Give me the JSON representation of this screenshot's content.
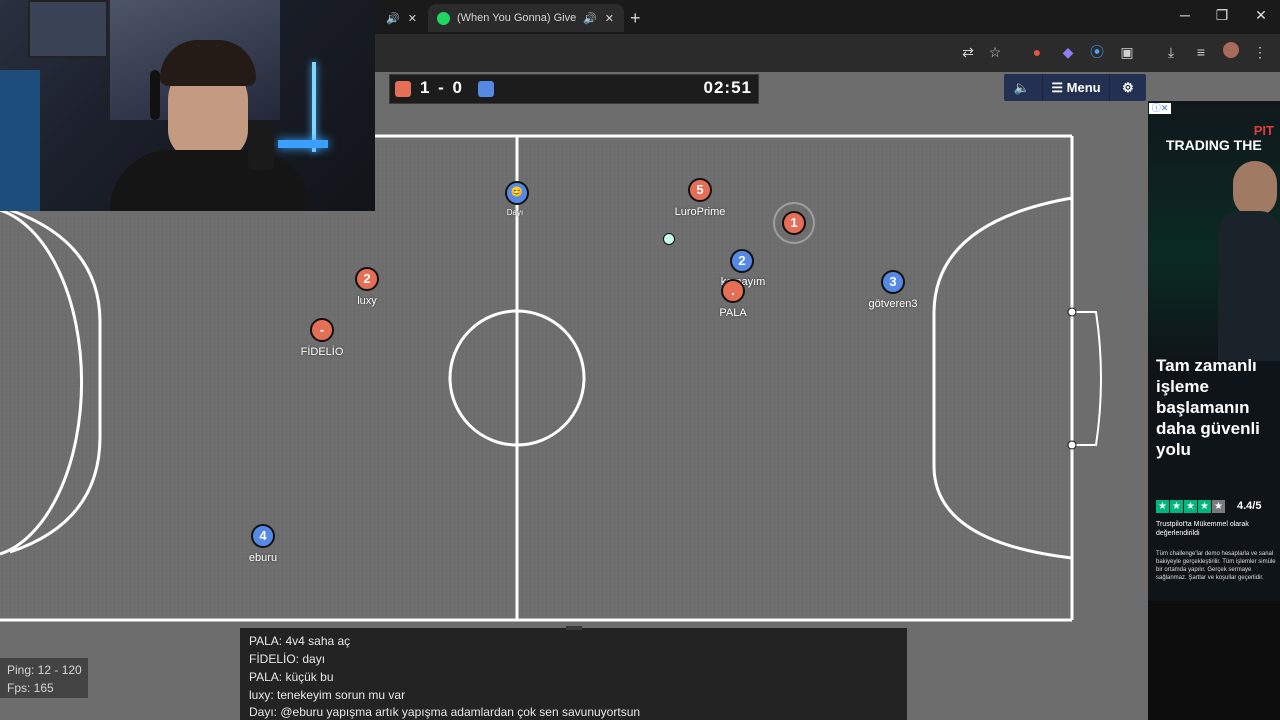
{
  "browser": {
    "tabs": [
      {
        "title": "(When You Gonna) Give It U"
      }
    ]
  },
  "hud": {
    "score": "1 - 0",
    "timer": "02:51",
    "menu_label": "Menu",
    "colors": {
      "red": "#e56e56",
      "blue": "#5689e5"
    }
  },
  "players": [
    {
      "label": "5",
      "name": "LuroPrime",
      "team": "red"
    },
    {
      "label": "1",
      "name": "",
      "team": "red"
    },
    {
      "label": "2",
      "name": "luxy",
      "team": "red"
    },
    {
      "label": "-",
      "name": "FİDELİO",
      "team": "red"
    },
    {
      "label": ".",
      "name": "PALA",
      "team": "red"
    },
    {
      "label": "2",
      "name": "kemayım",
      "team": "blue"
    },
    {
      "label": "3",
      "name": "götveren3",
      "team": "blue"
    },
    {
      "label": "4",
      "name": "eburu",
      "team": "blue"
    },
    {
      "label": "😊",
      "name": "Dayı",
      "team": "blue"
    }
  ],
  "ad": {
    "brand": "PIT",
    "headline": "TRADING THE",
    "body": "Tam zamanlı işleme başlamanın daha güvenli yolu",
    "rating": "4.4/5",
    "trust": "Trustpilot'ta Mükemmel olarak değerlendirildi",
    "fine": "Tüm challenge'lar demo hesaplarla ve sanal bakiyeyle gerçekleştirilir. Tüm işlemler simüle bir ortamda yapılır. Gerçek sermaye sağlanmaz. Şartlar ve koşullar geçerlidir."
  },
  "chat": [
    "PALA: 4v4 saha aç",
    "FİDELİO: dayı",
    "PALA: küçük bu",
    "luxy: tenekeyim sorun mu var",
    "Dayı: @eburu yapışma artık yapışma adamlardan çok sen savunuyortsun"
  ],
  "stats": {
    "ping": "Ping: 12 - 120",
    "fps": "Fps: 165"
  }
}
